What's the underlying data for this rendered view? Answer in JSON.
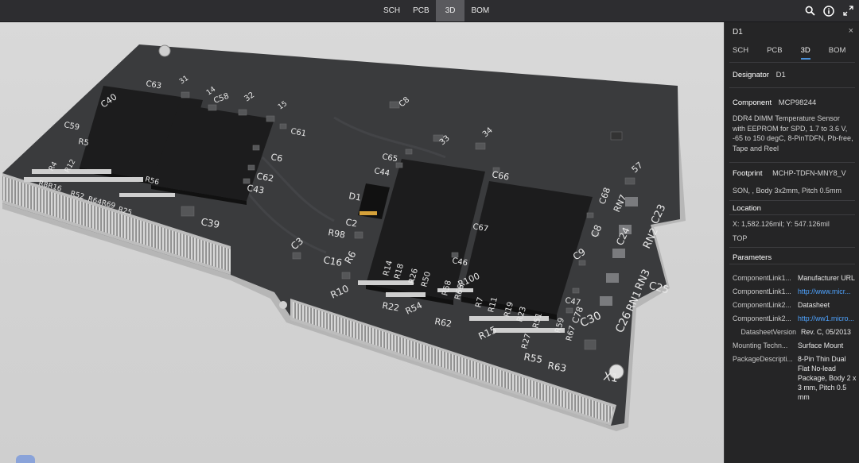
{
  "toolbar": {
    "tabs": [
      "SCH",
      "PCB",
      "3D",
      "BOM"
    ],
    "active_tab": "3D",
    "icons": [
      "search-icon",
      "info-icon",
      "fullscreen-icon"
    ]
  },
  "board": {
    "labels": {
      "c63": "C63",
      "r31": "31",
      "r14": "14",
      "c40": "C40",
      "c58": "C58",
      "r32": "32",
      "r15": "15",
      "c59": "C59",
      "r5": "R5",
      "c61": "C61",
      "c6": "C6",
      "c62": "C62",
      "c43": "C43",
      "r4": "R4",
      "r12": "R12",
      "r8r16": "R8R16",
      "r52": "R52",
      "r64r69": "R64R69",
      "r25": "R25",
      "r56": "R56",
      "c39": "C39",
      "c8top": "C8",
      "r34": "34",
      "r33": "33",
      "c65": "C65",
      "c44": "C44",
      "c66": "C66",
      "r57": "57",
      "d1": "D1",
      "c2": "C2",
      "r98": "R98",
      "c3": "C3",
      "c16": "C16",
      "r6": "R6",
      "r10": "R10",
      "r14b": "R14",
      "r18": "R18",
      "r26": "R26",
      "r50": "R50",
      "r22": "R22",
      "r54": "R54",
      "r58": "R58",
      "r66": "R66",
      "r100": "R100",
      "r62": "R62",
      "c46": "C46",
      "c67": "C67",
      "r7": "R7",
      "r11": "R11",
      "r19": "R19",
      "r23": "R23",
      "r51": "R51",
      "r15b": "R15",
      "r27": "R27",
      "r59": "R59",
      "r67": "R67",
      "r55": "R55",
      "r63": "R63",
      "c47": "C47",
      "c78": "C78",
      "c30": "C30",
      "c26": "C26",
      "rn1": "RN1",
      "rn3": "RN3",
      "c25": "C25",
      "rn2": "RN2",
      "c23": "C23",
      "c24": "C24",
      "c9": "C9",
      "c8": "C8",
      "rn7": "RN7",
      "c68": "C68",
      "x1": "X1"
    }
  },
  "panel": {
    "title": "D1",
    "close": "×",
    "tabs": [
      "SCH",
      "PCB",
      "3D",
      "BOM"
    ],
    "active_tab": "3D",
    "designator_label": "Designator",
    "designator_value": "D1",
    "component_label": "Component",
    "component_value": "MCP98244",
    "description": "DDR4 DIMM Temperature Sensor with EEPROM for SPD, 1.7 to 3.6 V, -65 to 150 degC, 8-PinTDFN, Pb-free, Tape and Reel",
    "footprint_label": "Footprint",
    "footprint_value": "MCHP-TDFN-MNY8_V",
    "footprint_desc": "SON, , Body 3x2mm, Pitch 0.5mm",
    "location_label": "Location",
    "location_value": "X: 1,582.126mil; Y: 547.126mil",
    "location_side": "TOP",
    "parameters_label": "Parameters",
    "parameters": [
      {
        "key": "ComponentLink1...",
        "value": "Manufacturer URL",
        "link": false
      },
      {
        "key": "ComponentLink1...",
        "value": "http://www.micr...",
        "link": true
      },
      {
        "key": "ComponentLink2...",
        "value": "Datasheet",
        "link": false
      },
      {
        "key": "ComponentLink2...",
        "value": "http://ww1.micro...",
        "link": true
      },
      {
        "key": "DatasheetVersion",
        "value": "Rev. C, 05/2013",
        "link": false
      },
      {
        "key": "Mounting Techn...",
        "value": "Surface Mount",
        "link": false
      },
      {
        "key": "PackageDescripti...",
        "value": "8-Pin Thin Dual Flat No-lead Package, Body 2 x 3 mm, Pitch 0.5 mm",
        "link": false
      }
    ]
  }
}
